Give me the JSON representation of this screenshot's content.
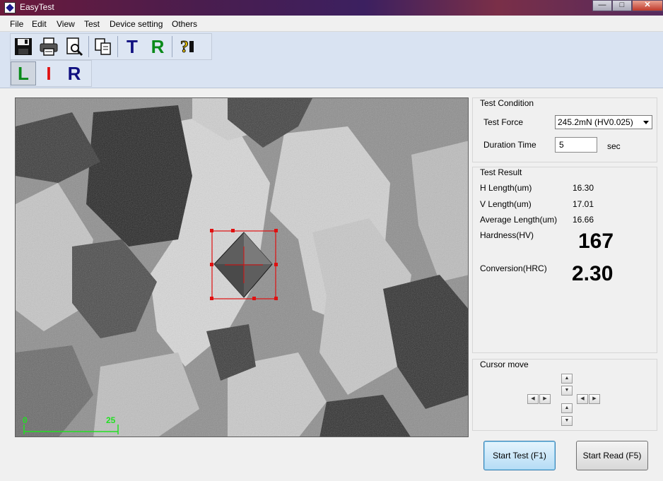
{
  "window": {
    "title": "EasyTest"
  },
  "menu": [
    "File",
    "Edit",
    "View",
    "Test",
    "Device setting",
    "Others"
  ],
  "toolbar": {
    "t_label": "T",
    "r_label": "R",
    "l_label": "L",
    "i_label": "I",
    "r2_label": "R"
  },
  "image": {
    "scale_start": "0",
    "scale_end": "25"
  },
  "condition": {
    "title": "Test Condition",
    "force_label": "Test Force",
    "force_value": "245.2mN (HV0.025)",
    "duration_label": "Duration Time",
    "duration_value": "5",
    "duration_unit": "sec"
  },
  "result": {
    "title": "Test Result",
    "h_label": "H Length(um)",
    "h_value": "16.30",
    "v_label": "V Length(um)",
    "v_value": "17.01",
    "avg_label": "Average Length(um)",
    "avg_value": "16.66",
    "hardness_label": "Hardness(HV)",
    "hardness_value": "167",
    "conversion_label": "Conversion(HRC)",
    "conversion_value": "2.30"
  },
  "cursor": {
    "title": "Cursor move"
  },
  "actions": {
    "start_test": "Start Test (F1)",
    "start_read": "Start Read (F5)"
  },
  "colors": {
    "green": "#0a8a1a",
    "red": "#e01010",
    "blue": "#101080"
  }
}
